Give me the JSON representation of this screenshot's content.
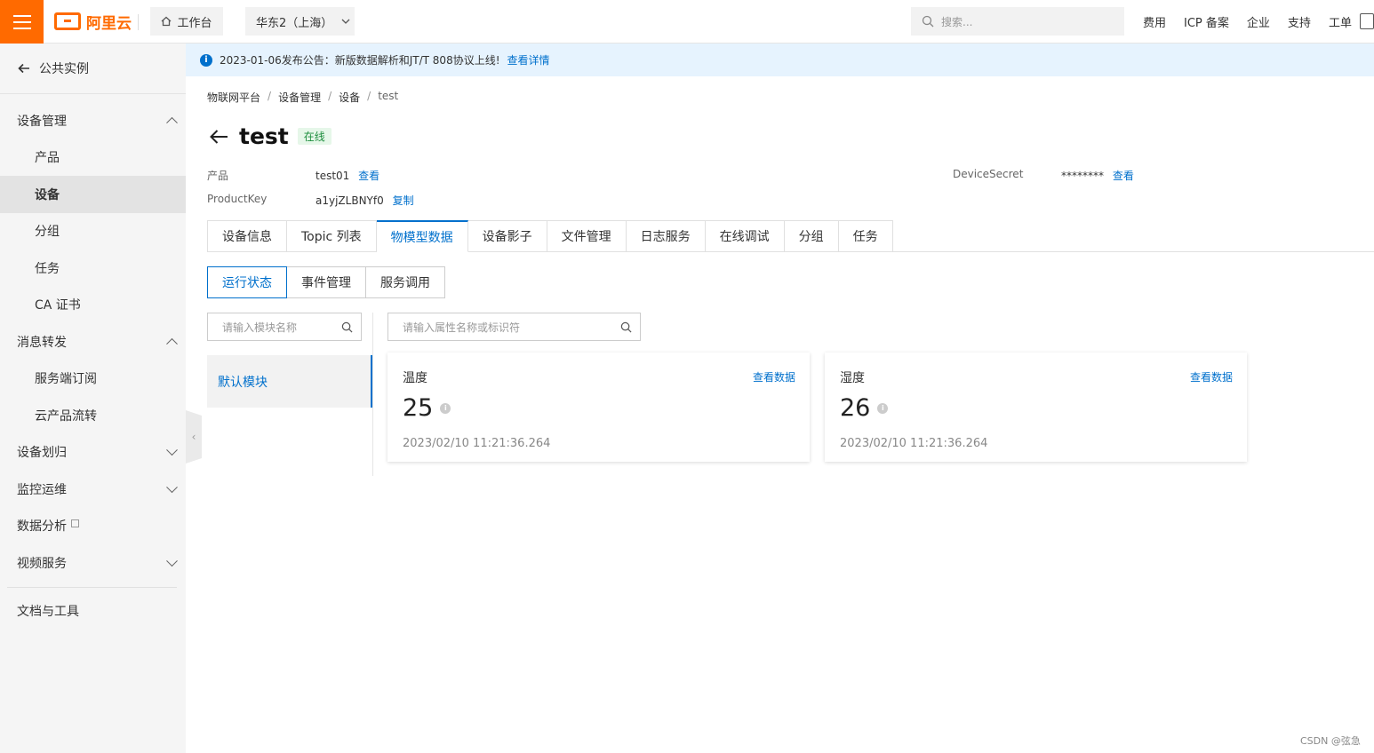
{
  "topbar": {
    "brand": "阿里云",
    "workbench": "工作台",
    "region": "华东2（上海）",
    "search_placeholder": "搜索...",
    "links": [
      "费用",
      "ICP 备案",
      "企业",
      "支持",
      "工单"
    ]
  },
  "sidebar": {
    "back": "公共实例",
    "items": [
      {
        "label": "设备管理",
        "type": "group",
        "chevron": "up"
      },
      {
        "label": "产品",
        "type": "sub"
      },
      {
        "label": "设备",
        "type": "sub",
        "active": true
      },
      {
        "label": "分组",
        "type": "sub"
      },
      {
        "label": "任务",
        "type": "sub"
      },
      {
        "label": "CA 证书",
        "type": "sub"
      },
      {
        "label": "消息转发",
        "type": "group",
        "chevron": "up"
      },
      {
        "label": "服务端订阅",
        "type": "sub"
      },
      {
        "label": "云产品流转",
        "type": "sub"
      },
      {
        "label": "设备划归",
        "type": "group",
        "chevron": "down"
      },
      {
        "label": "监控运维",
        "type": "group",
        "chevron": "down"
      },
      {
        "label": "数据分析",
        "type": "group",
        "external": true
      },
      {
        "label": "视频服务",
        "type": "group",
        "chevron": "down"
      }
    ],
    "footer": "文档与工具"
  },
  "notice": {
    "text": "2023-01-06发布公告：新版数据解析和JT/T 808协议上线!",
    "link": "查看详情"
  },
  "breadcrumb": [
    "物联网平台",
    "设备管理",
    "设备",
    "test"
  ],
  "device": {
    "name": "test",
    "status": "在线",
    "product_label": "产品",
    "product_value": "test01",
    "product_link": "查看",
    "productkey_label": "ProductKey",
    "productkey_value": "a1yjZLBNYf0",
    "productkey_link": "复制",
    "secret_label": "DeviceSecret",
    "secret_value": "********",
    "secret_link": "查看"
  },
  "tabs": [
    "设备信息",
    "Topic 列表",
    "物模型数据",
    "设备影子",
    "文件管理",
    "日志服务",
    "在线调试",
    "分组",
    "任务"
  ],
  "active_tab": 2,
  "subtabs": [
    "运行状态",
    "事件管理",
    "服务调用"
  ],
  "active_subtab": 0,
  "module_search_placeholder": "请输入模块名称",
  "property_search_placeholder": "请输入属性名称或标识符",
  "module": "默认模块",
  "properties": [
    {
      "name": "温度",
      "value": "25",
      "time": "2023/02/10 11:21:36.264",
      "link": "查看数据"
    },
    {
      "name": "湿度",
      "value": "26",
      "time": "2023/02/10 11:21:36.264",
      "link": "查看数据"
    }
  ],
  "watermark": "CSDN @弦急"
}
